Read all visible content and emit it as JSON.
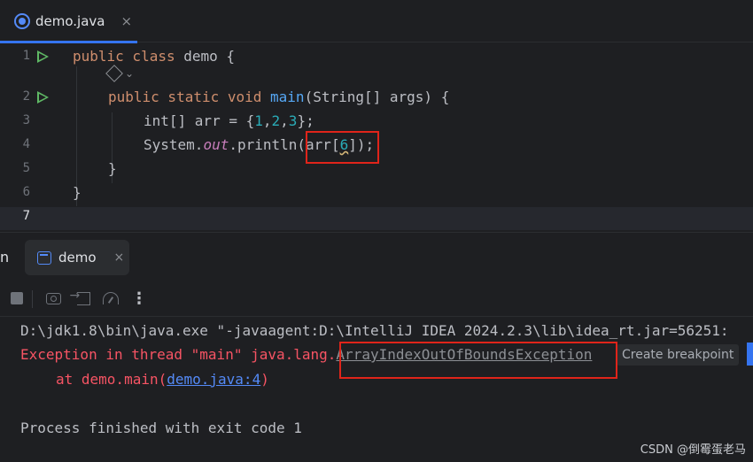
{
  "editor_tab": {
    "label": "demo.java",
    "close": "×"
  },
  "editor": {
    "lines": [
      {
        "num": "1",
        "has_run": true
      },
      {
        "num": "2",
        "has_run": true
      },
      {
        "num": "3",
        "has_run": false
      },
      {
        "num": "4",
        "has_run": false
      },
      {
        "num": "5",
        "has_run": false
      },
      {
        "num": "6",
        "has_run": false
      },
      {
        "num": "7",
        "has_run": false
      }
    ],
    "code": {
      "l1_kw": "public class",
      "l1_rest": " demo {",
      "l2_kw": "public static void",
      "l2_fn": "main",
      "l2_rest": "(String[] args) {",
      "l3_a": "int[] arr = {",
      "l3_n1": "1",
      "l3_n2": "2",
      "l3_n3": "3",
      "l3_b": "};",
      "l4_a": "System.",
      "l4_field": "out",
      "l4_b": ".println(arr[",
      "l4_idx": "6",
      "l4_c": "]);",
      "l5": "}",
      "l6": "}"
    }
  },
  "tool_window": {
    "fragment": "n",
    "run_tab_label": "demo",
    "run_tab_close": "×",
    "more_label": "⋮"
  },
  "console": {
    "command": "D:\\jdk1.8\\bin\\java.exe \"-javaagent:D:\\IntelliJ IDEA 2024.2.3\\lib\\idea_rt.jar=56251:",
    "exc_prefix": "Exception in thread \"main\" java.lang.",
    "exc_class": "ArrayIndexOutOfBoundsException",
    "tooltip": "Create breakpoint",
    "at_prefix": "at demo.main(",
    "at_link": "demo.java:4",
    "at_suffix": ")",
    "finished": "Process finished with exit code 1"
  },
  "watermark": "CSDN @倒霉蛋老马",
  "colors": {
    "accent": "#3574f0",
    "keyword": "#cf8e6d",
    "error": "#f75464",
    "highlight_box": "#e0241a"
  }
}
